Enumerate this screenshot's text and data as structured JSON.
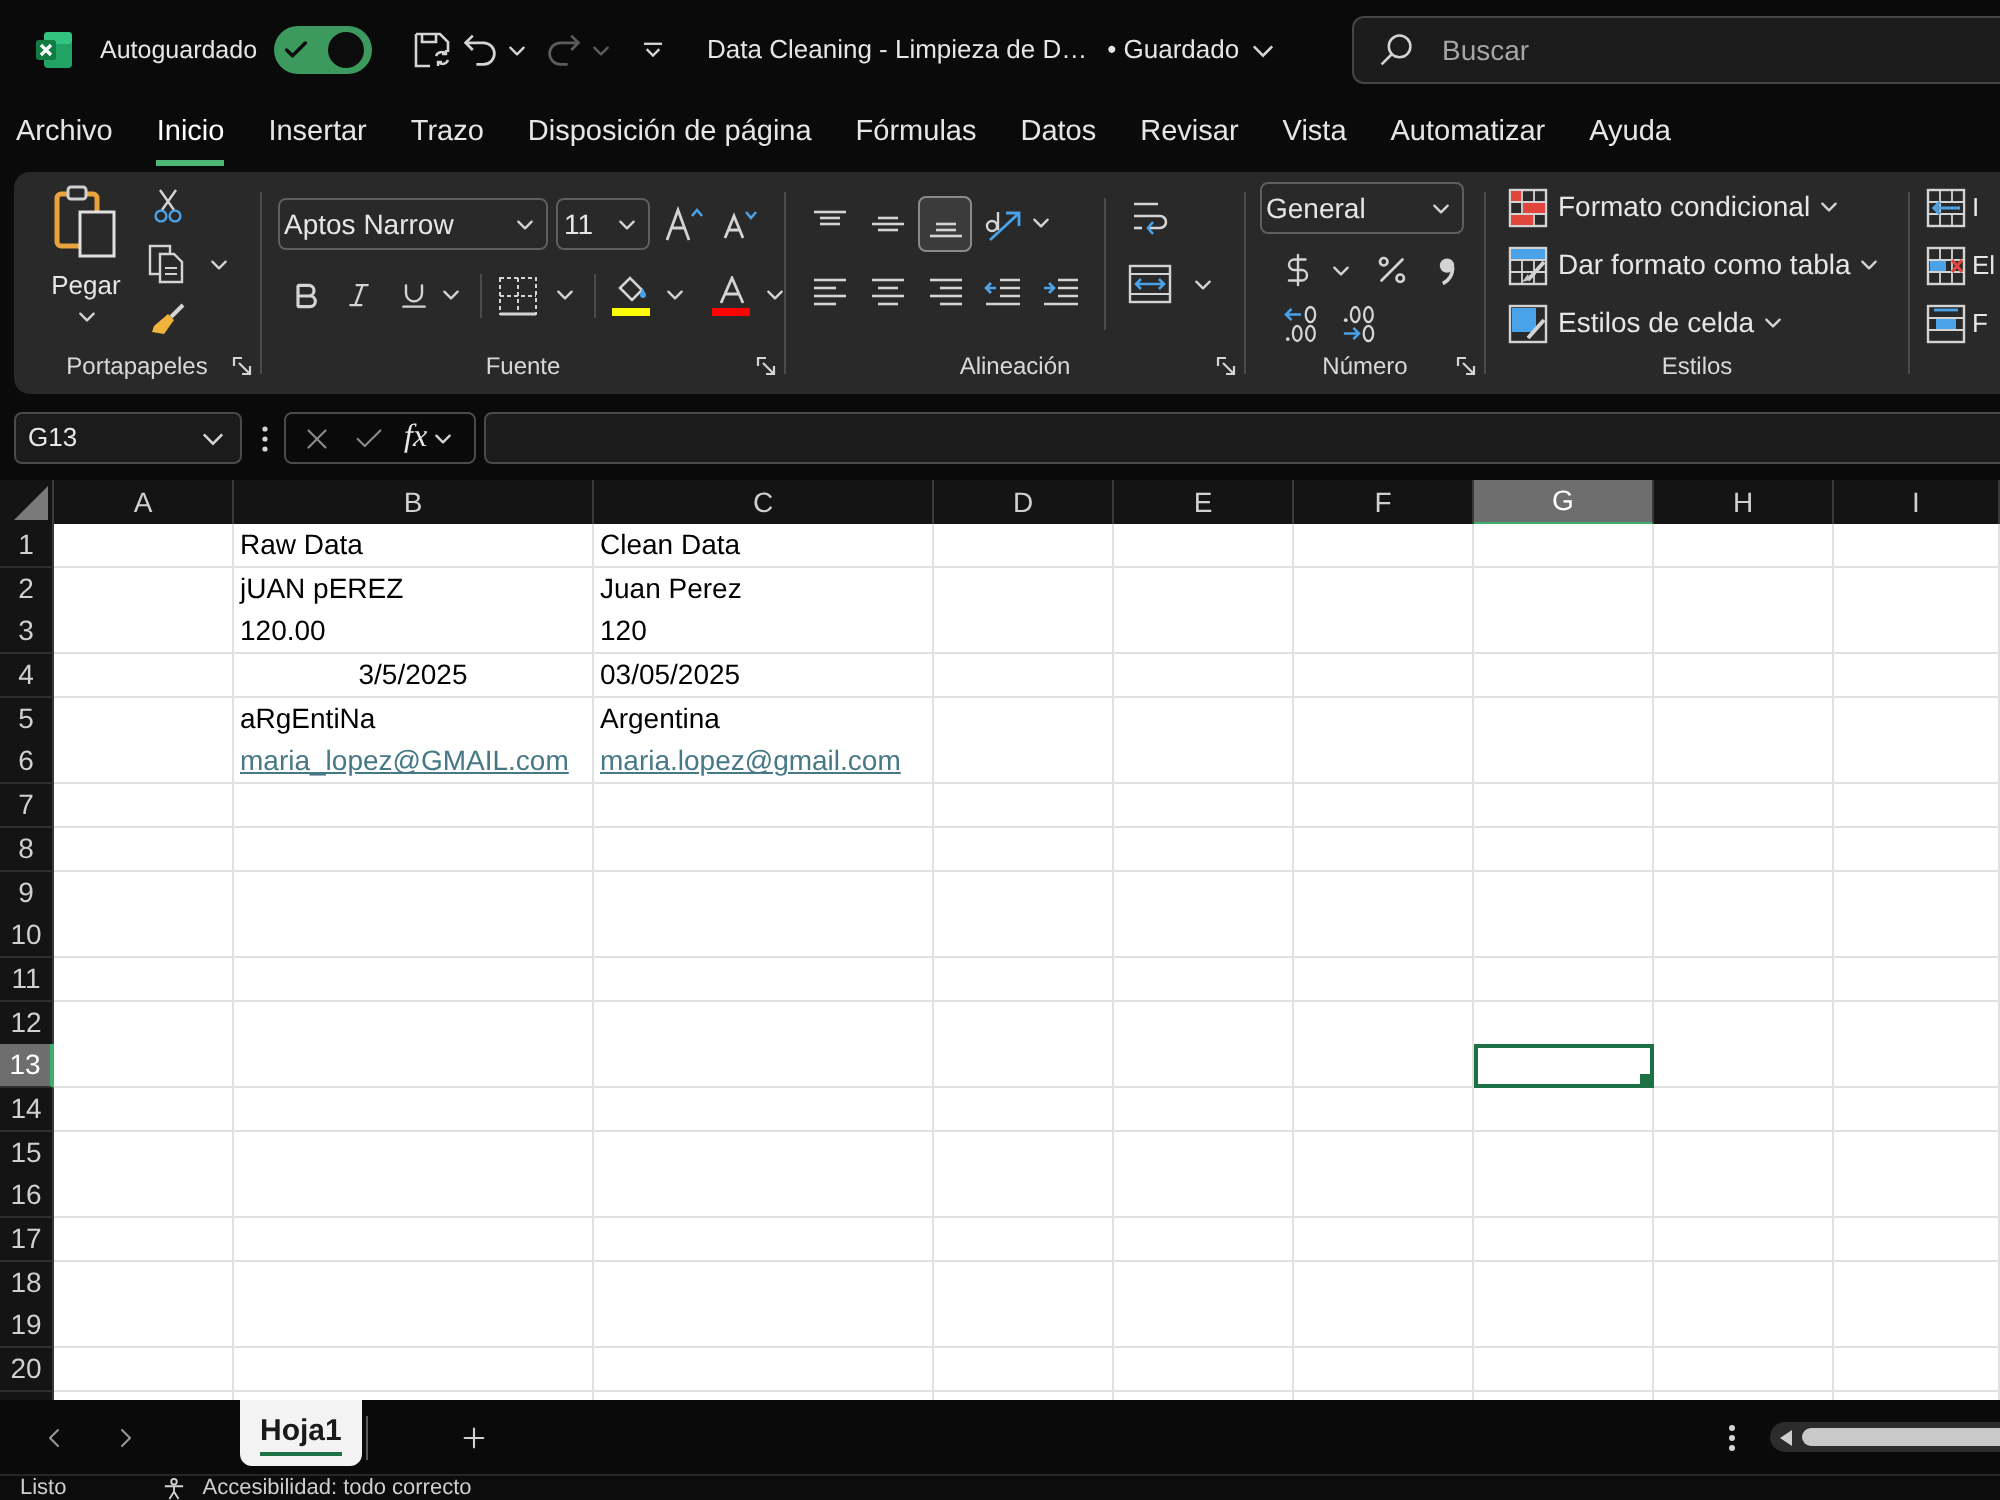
{
  "title_bar": {
    "autosave_label": "Autoguardado",
    "autosave_on": true,
    "document_title": "Data Cleaning - Limpieza de D…",
    "save_status": "• Guardado",
    "search_placeholder": "Buscar"
  },
  "menu_tabs": [
    {
      "label": "Archivo",
      "selected": false
    },
    {
      "label": "Inicio",
      "selected": true
    },
    {
      "label": "Insertar",
      "selected": false
    },
    {
      "label": "Trazo",
      "selected": false
    },
    {
      "label": "Disposición de página",
      "selected": false
    },
    {
      "label": "Fórmulas",
      "selected": false
    },
    {
      "label": "Datos",
      "selected": false
    },
    {
      "label": "Revisar",
      "selected": false
    },
    {
      "label": "Vista",
      "selected": false
    },
    {
      "label": "Automatizar",
      "selected": false
    },
    {
      "label": "Ayuda",
      "selected": false
    }
  ],
  "ribbon": {
    "clipboard": {
      "paste_label": "Pegar",
      "group_label": "Portapapeles"
    },
    "font": {
      "font_name": "Aptos Narrow",
      "font_size": "11",
      "color_buttons": [
        {
          "kind": "fill",
          "color": "#ffff00"
        },
        {
          "kind": "font",
          "color": "#ff0000"
        }
      ],
      "group_label": "Fuente"
    },
    "alignment": {
      "vertical": [
        {
          "kind": "top",
          "selected": false
        },
        {
          "kind": "middle",
          "selected": false
        },
        {
          "kind": "bottom",
          "selected": true
        }
      ],
      "group_label": "Alineación"
    },
    "number": {
      "format": "General",
      "group_label": "Número"
    },
    "styles": {
      "commands": [
        {
          "kind": "conditional",
          "label": "Formato condicional"
        },
        {
          "kind": "table",
          "label": "Dar formato como tabla"
        },
        {
          "kind": "cell",
          "label": "Estilos de celda"
        }
      ],
      "group_label": "Estilos"
    },
    "cells": {
      "commands": [
        {
          "kind": "insert",
          "label": "I"
        },
        {
          "kind": "delete",
          "label": "El"
        },
        {
          "kind": "format",
          "label": "F"
        }
      ]
    }
  },
  "formula_bar": {
    "name_box": "G13",
    "function_label": "fx"
  },
  "sheet": {
    "columns": [
      {
        "label": "A",
        "selected": false
      },
      {
        "label": "B",
        "selected": false
      },
      {
        "label": "C",
        "selected": false
      },
      {
        "label": "D",
        "selected": false
      },
      {
        "label": "E",
        "selected": false
      },
      {
        "label": "F",
        "selected": false
      },
      {
        "label": "G",
        "selected": true
      },
      {
        "label": "H",
        "selected": false
      },
      {
        "label": "I",
        "selected": false
      }
    ],
    "rows": [
      {
        "header": "1",
        "selected": false,
        "cells": [
          {
            "kind": "text",
            "text": "Raw Data"
          },
          {
            "kind": "text",
            "text": "Clean Data"
          }
        ]
      },
      {
        "header": "2",
        "selected": false,
        "cells": [
          {
            "kind": "text",
            "text": "jUAN pEREZ"
          },
          {
            "kind": "text",
            "text": "Juan Perez"
          }
        ]
      },
      {
        "header": "3",
        "selected": false,
        "cells": [
          {
            "kind": "text",
            "text": "120.00"
          },
          {
            "kind": "text",
            "text": "120"
          }
        ]
      },
      {
        "header": "4",
        "selected": false,
        "cells": [
          {
            "kind": "centered",
            "text": "3/5/2025"
          },
          {
            "kind": "text",
            "text": "03/05/2025"
          }
        ]
      },
      {
        "header": "5",
        "selected": false,
        "cells": [
          {
            "kind": "text",
            "text": "aRgEntiNa"
          },
          {
            "kind": "text",
            "text": "Argentina"
          }
        ]
      },
      {
        "header": "6",
        "selected": false,
        "cells": [
          {
            "kind": "link",
            "text": "maria_lopez@GMAIL.com"
          },
          {
            "kind": "link",
            "text": "maria.lopez@gmail.com"
          }
        ]
      },
      {
        "header": "7",
        "selected": false
      },
      {
        "header": "8",
        "selected": false
      },
      {
        "header": "9",
        "selected": false
      },
      {
        "header": "10",
        "selected": false
      },
      {
        "header": "11",
        "selected": false
      },
      {
        "header": "12",
        "selected": false
      },
      {
        "header": "13",
        "selected": true
      },
      {
        "header": "14",
        "selected": false
      },
      {
        "header": "15",
        "selected": false
      },
      {
        "header": "16",
        "selected": false
      },
      {
        "header": "17",
        "selected": false
      },
      {
        "header": "18",
        "selected": false
      },
      {
        "header": "19",
        "selected": false
      },
      {
        "header": "20",
        "selected": false
      }
    ]
  },
  "sheet_tabs": [
    {
      "label": "Hoja1",
      "selected": true
    }
  ],
  "status_bar": {
    "ready": "Listo",
    "accessibility": "Accesibilidad: todo correcto"
  }
}
